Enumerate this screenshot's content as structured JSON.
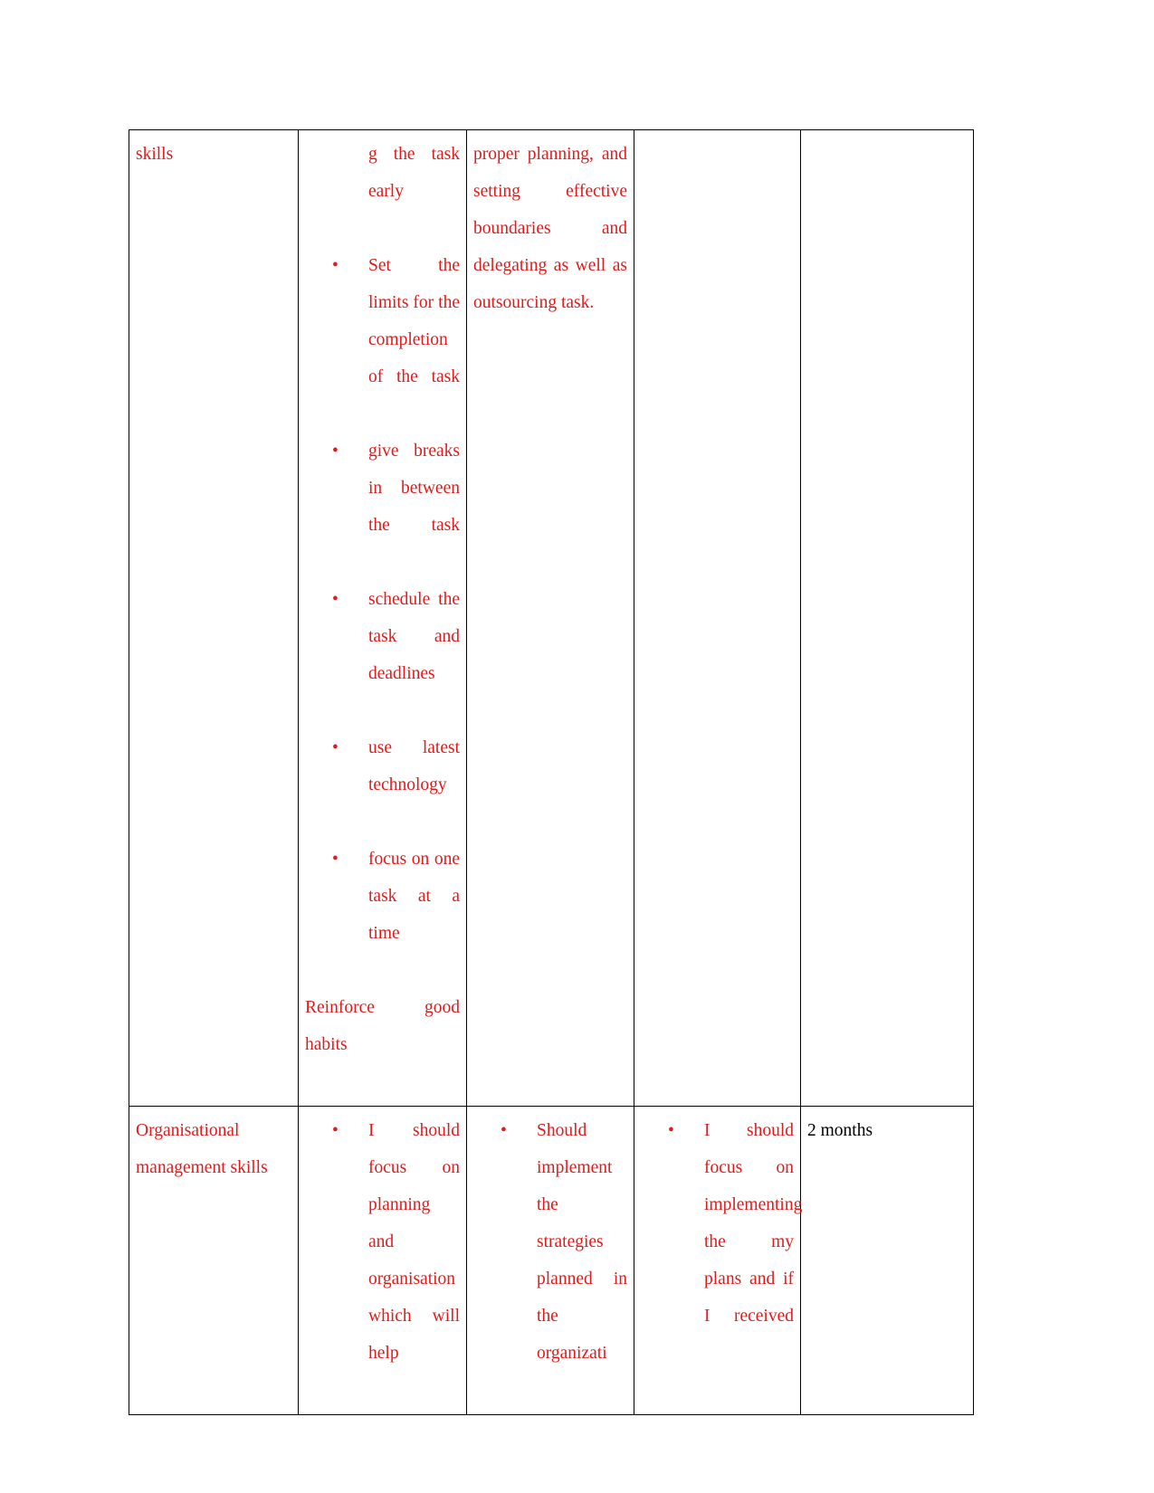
{
  "document": {
    "page_background": "#ffffff",
    "text_color_red": "#E01B1B",
    "text_color_black": "#000000",
    "table": {
      "columns": 5,
      "rows": [
        {
          "row_name": "time-management-skills-row-continued",
          "cells": {
            "col1_label": "skills",
            "col2_intro_continued": "g the task early",
            "col2_bullets": [
              "Set the limits for the completion of the task",
              "give breaks in between the task",
              "schedule the task and deadlines",
              "use latest technology",
              "focus on one task at a time"
            ],
            "col2_trailing_paragraph": "Reinforce good habits",
            "col3_text": "proper planning, and setting effective boundaries and delegating as well as outsourcing task.",
            "col4_text": "",
            "col5_text": ""
          }
        },
        {
          "row_name": "organisational-management-skills-row",
          "cells": {
            "col1_label": "Organisational management skills",
            "col2_bullets": [
              "I should focus on planning and organisation which will help"
            ],
            "col3_bullets": [
              "Should implement the strategies planned in the organizati"
            ],
            "col4_bullets": [
              "I should focus on implementing the my plans and if I received"
            ],
            "col5_text": "2 months"
          }
        }
      ]
    }
  }
}
